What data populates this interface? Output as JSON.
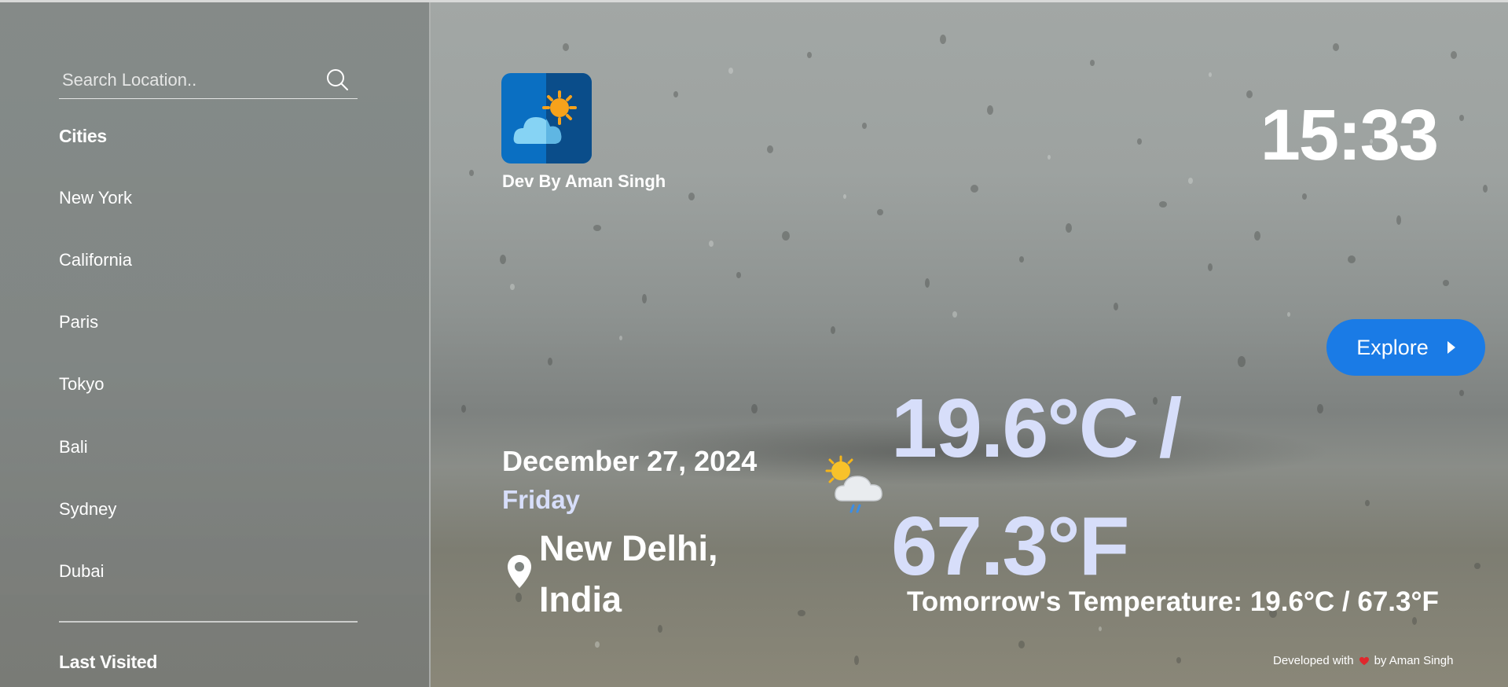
{
  "search": {
    "placeholder": "Search Location.."
  },
  "sidebar": {
    "cities_title": "Cities",
    "cities": [
      "New York",
      "California",
      "Paris",
      "Tokyo",
      "Bali",
      "Sydney",
      "Dubai"
    ],
    "last_visited_title": "Last Visited"
  },
  "header": {
    "logo_caption": "Dev By Aman Singh",
    "time": "15:33",
    "explore_label": "Explore"
  },
  "weather": {
    "date": "December 27, 2024",
    "day": "Friday",
    "location_line1": "New Delhi,",
    "location_line2": "India",
    "temp_line1": "19.6°C /",
    "temp_line2": "67.3°F",
    "tomorrow": "Tomorrow's Temperature: 19.6°C / 67.3°F",
    "icon": "sun-behind-rain-cloud-icon"
  },
  "footer": {
    "prefix": "Developed with",
    "suffix": "by Aman Singh",
    "icon": "heart-icon"
  },
  "colors": {
    "accent": "#1a7be6",
    "temperature": "#d7defa",
    "text": "#ffffff"
  }
}
